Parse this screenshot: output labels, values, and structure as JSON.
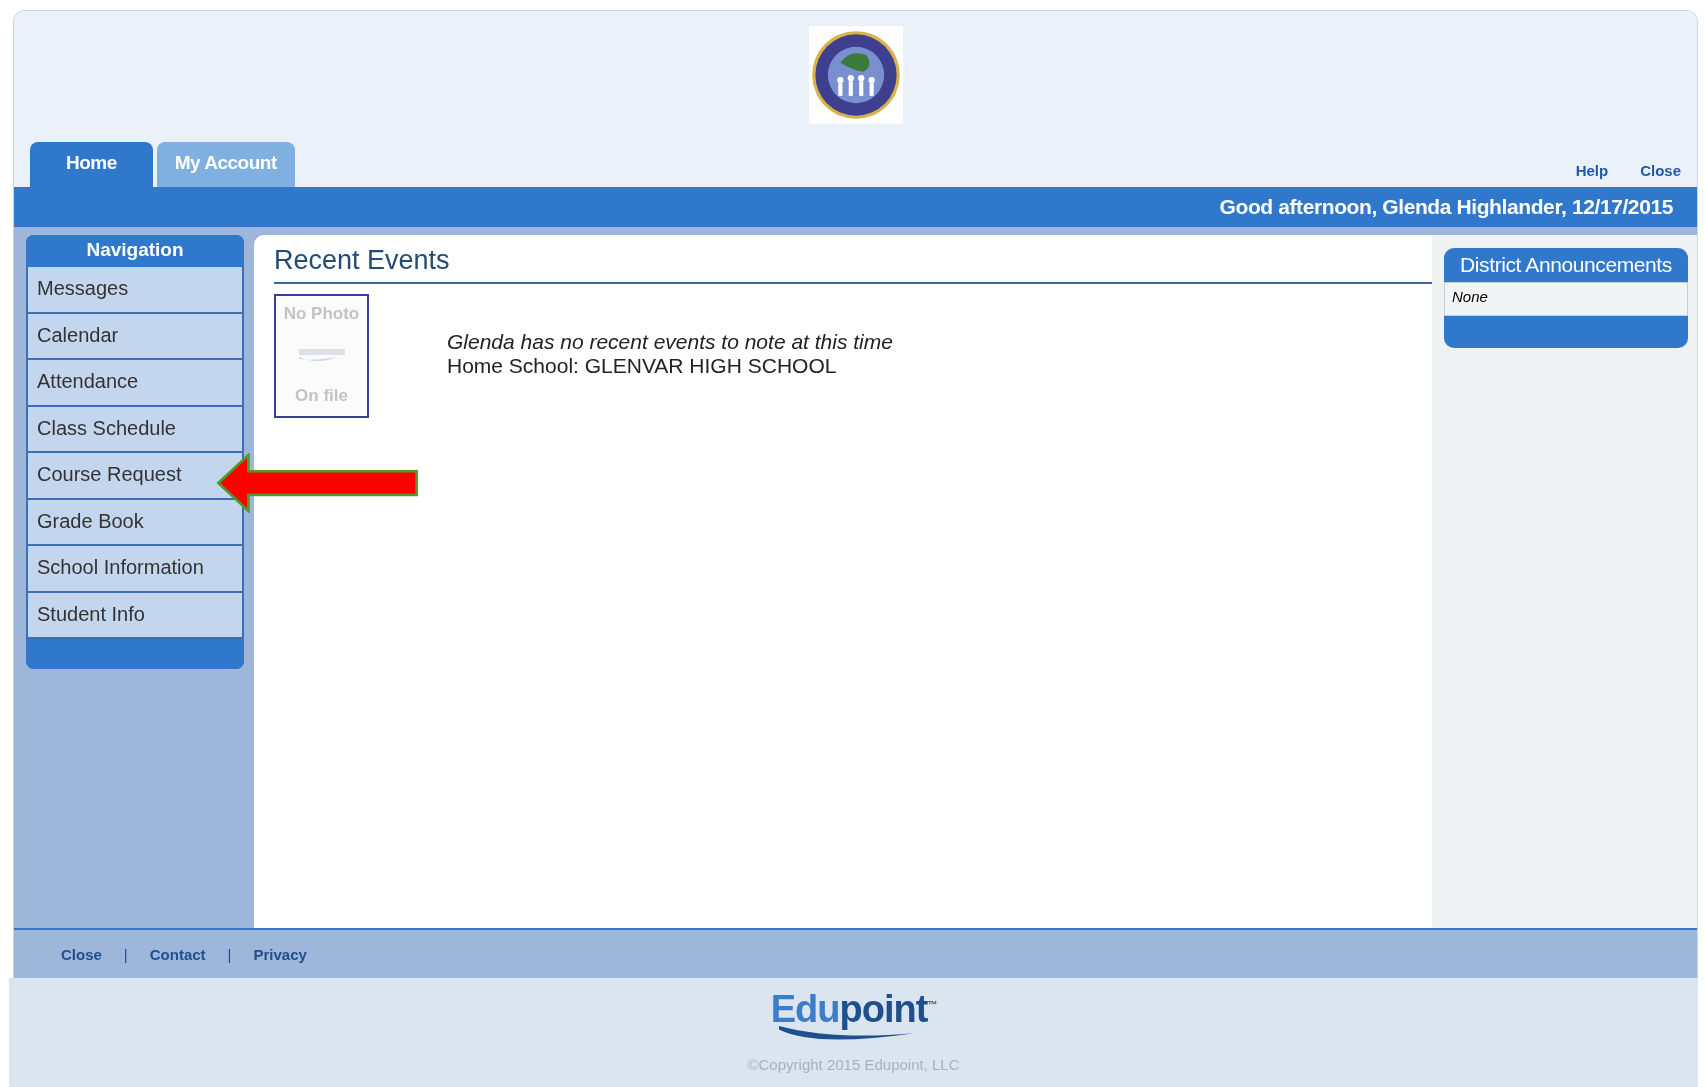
{
  "tabs": [
    {
      "label": "Home",
      "selected": true
    },
    {
      "label": "My Account",
      "selected": false
    }
  ],
  "header_links": [
    "Help",
    "Close"
  ],
  "greeting": "Good afternoon, Glenda Highlander, 12/17/2015",
  "navigation": {
    "title": "Navigation",
    "items": [
      {
        "label": "Messages"
      },
      {
        "label": "Calendar"
      },
      {
        "label": "Attendance"
      },
      {
        "label": "Class Schedule"
      },
      {
        "label": "Course Request"
      },
      {
        "label": "Grade Book"
      },
      {
        "label": "School Information"
      },
      {
        "label": "Student Info"
      }
    ]
  },
  "recent_events": {
    "title": "Recent Events",
    "photo": {
      "top": "No Photo",
      "bottom": "On file"
    },
    "message": "Glenda has no recent events to note at this time",
    "home_school": "Home School: GLENVAR HIGH SCHOOL"
  },
  "announcements": {
    "title": "District Announcements",
    "body": "None"
  },
  "footer_links": [
    "Close",
    "Contact",
    "Privacy"
  ],
  "footer_separator": "|",
  "brand": {
    "parts": [
      "Edu",
      "point"
    ],
    "mark": "™"
  },
  "copyright": "©Copyright 2015 Edupoint, LLC"
}
